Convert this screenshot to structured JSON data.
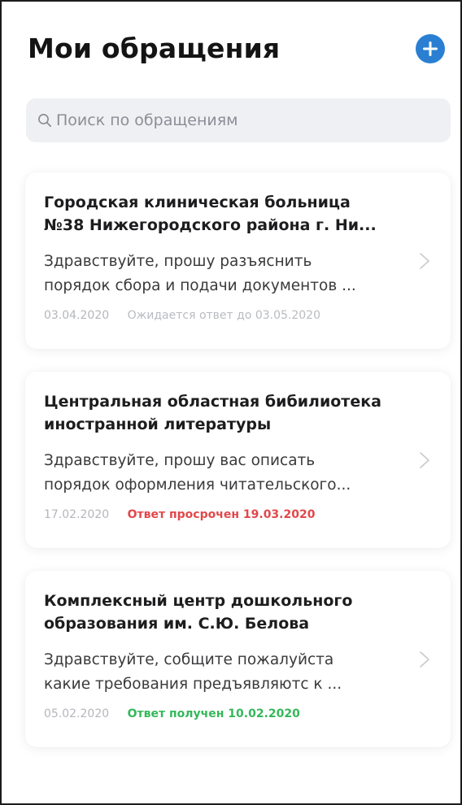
{
  "header": {
    "title": "Мои обращения",
    "add_icon": "plus-circle-icon",
    "accent_color": "#2a7fd2"
  },
  "search": {
    "placeholder": "Поиск по обращениям",
    "icon": "search-icon"
  },
  "appeals": [
    {
      "org_line1": "Городская клиническая больница",
      "org_line2": "№38 Нижегородского района г. Ни...",
      "preview_line1": "Здравствуйте, прошу разъяснить",
      "preview_line2": "порядок сбора и подачи документов ...",
      "date": "03.04.2020",
      "status": "Ожидается ответ до 03.05.2020",
      "status_type": "waiting",
      "status_color": "#b9bbc1"
    },
    {
      "org_line1": "Центральная областная бибилиотека",
      "org_line2": "иностранной литературы",
      "preview_line1": "Здравствуйте, прошу вас описать",
      "preview_line2": "порядок оформления читательского...",
      "date": "17.02.2020",
      "status": "Ответ просрочен 19.03.2020",
      "status_type": "overdue",
      "status_color": "#e2474a"
    },
    {
      "org_line1": "Комплексный центр дошкольного",
      "org_line2": "образования им. С.Ю. Белова",
      "preview_line1": "Здравствуйте, собщите пожалуйста",
      "preview_line2": "какие требования предъявляютс к ...",
      "date": "05.02.2020",
      "status": "Ответ получен 10.02.2020",
      "status_type": "received",
      "status_color": "#34b85a"
    }
  ]
}
